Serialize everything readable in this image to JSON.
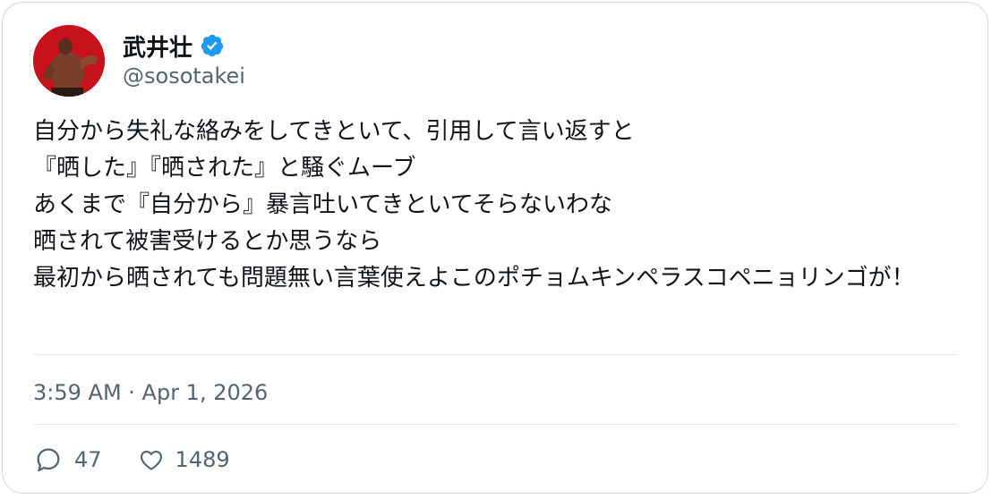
{
  "user": {
    "display_name": "武井壮",
    "handle": "@sosotakei",
    "verified": true
  },
  "tweet": {
    "text": "自分から失礼な絡みをしてきといて、引用して言い返すと\n『晒した』『晒された』と騒ぐムーブ\nあくまで『自分から』暴言吐いてきといてそらないわな\n晒されて被害受けるとか思うなら\n最初から晒されても問題無い言葉使えよこのポチョムキンペラスコペニョリンゴが！",
    "timestamp": "3:59 AM · Apr 1, 2026"
  },
  "stats": {
    "replies": "47",
    "likes": "1489"
  },
  "colors": {
    "verified_badge": "#1d9bf0",
    "text_primary": "#0f1419",
    "text_secondary": "#536471",
    "avatar_bg": "#c5121b"
  },
  "icons": {
    "verified": "verified-badge-icon",
    "reply": "reply-bubble-icon",
    "like": "heart-icon"
  }
}
